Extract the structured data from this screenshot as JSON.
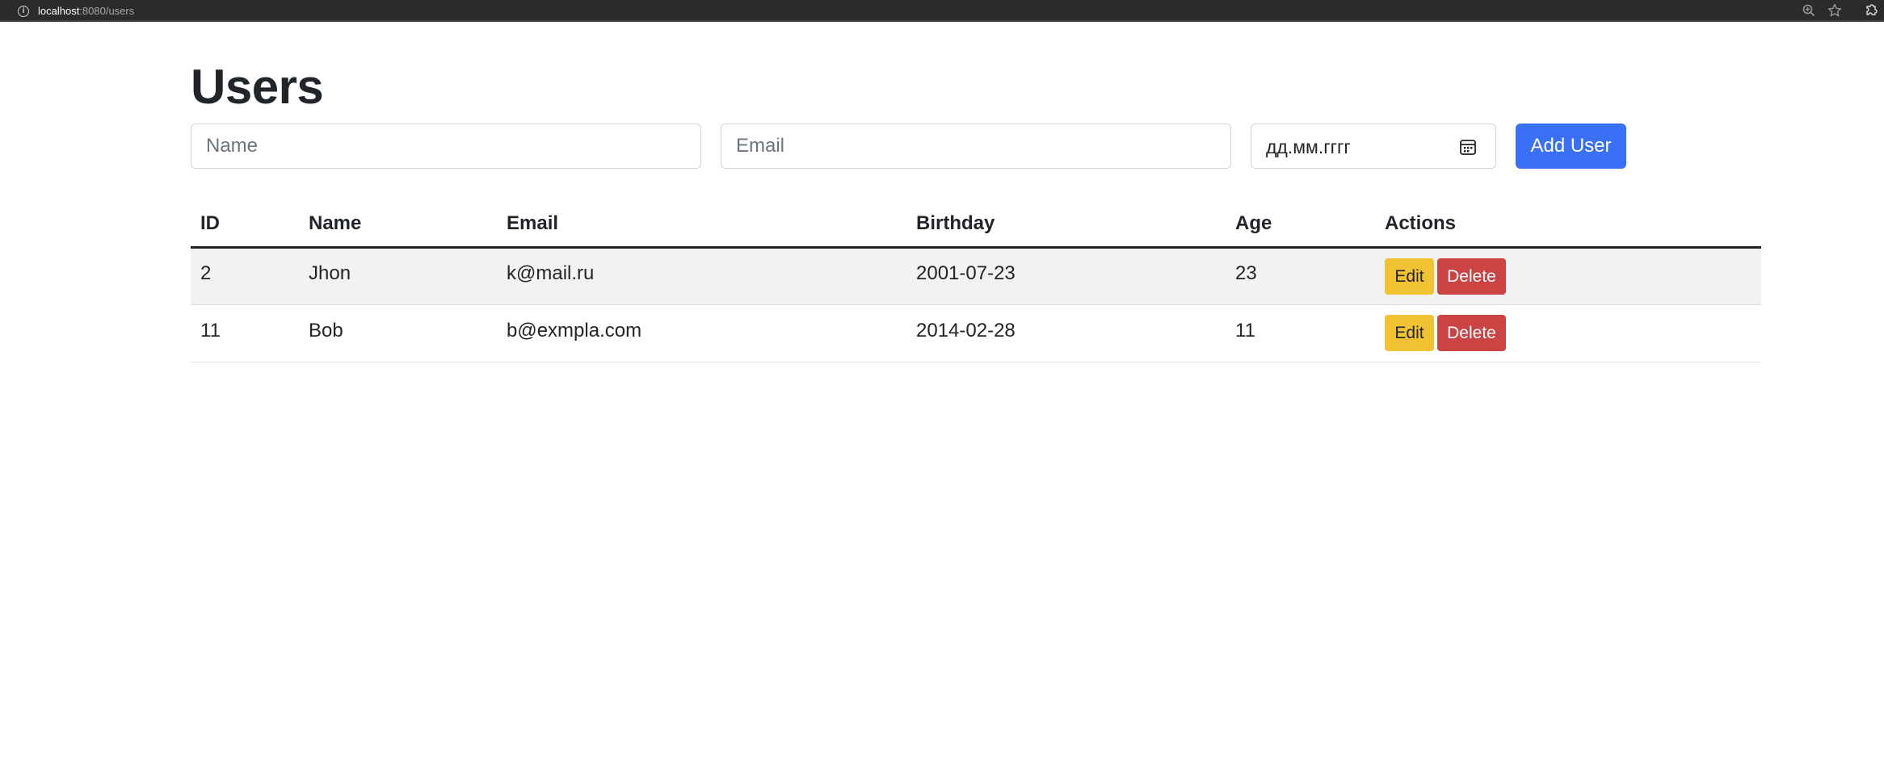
{
  "browser": {
    "url_host": "localhost",
    "url_path": ":8080/users"
  },
  "page": {
    "title": "Users"
  },
  "form": {
    "name_placeholder": "Name",
    "email_placeholder": "Email",
    "date_placeholder": "дд.мм.гггг",
    "add_button_label": "Add User"
  },
  "table": {
    "headers": [
      "ID",
      "Name",
      "Email",
      "Birthday",
      "Age",
      "Actions"
    ],
    "rows": [
      {
        "id": "2",
        "name": "Jhon",
        "email": "k@mail.ru",
        "birthday": "2001-07-23",
        "age": "23"
      },
      {
        "id": "11",
        "name": "Bob",
        "email": "b@exmpla.com",
        "birthday": "2014-02-28",
        "age": "11"
      }
    ],
    "edit_label": "Edit",
    "delete_label": "Delete"
  },
  "colors": {
    "primary": "#3a70f5",
    "warning": "#f1c232",
    "danger": "#cc4343",
    "stripe": "#f2f2f2"
  },
  "icons": [
    "info-icon",
    "zoom-icon",
    "star-icon",
    "extensions-icon",
    "calendar-icon"
  ]
}
